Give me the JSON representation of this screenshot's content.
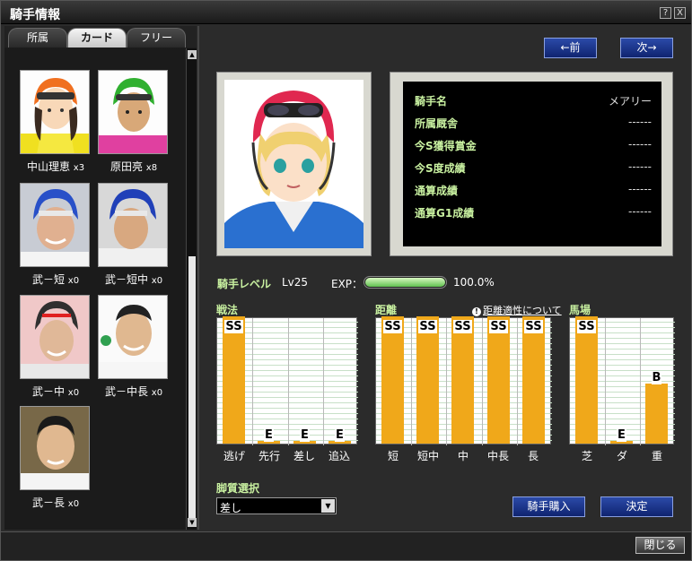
{
  "window": {
    "title": "騎手情報",
    "help": "?",
    "close": "X"
  },
  "tabs": [
    {
      "label": "所属"
    },
    {
      "label": "カード"
    },
    {
      "label": "フリー"
    }
  ],
  "cards": [
    {
      "name": "中山理恵",
      "count": "x3"
    },
    {
      "name": "原田亮",
      "count": "x8"
    },
    {
      "name": "武－短",
      "count": "x0"
    },
    {
      "name": "武－短中",
      "count": "x0"
    },
    {
      "name": "武－中",
      "count": "x0"
    },
    {
      "name": "武－中長",
      "count": "x0"
    },
    {
      "name": "武－長",
      "count": "x0"
    }
  ],
  "nav": {
    "prev": "←前",
    "next": "次→"
  },
  "info": [
    {
      "label": "騎手名",
      "value": "メアリー"
    },
    {
      "label": "所属厩舎",
      "value": "------"
    },
    {
      "label": "今S獲得賞金",
      "value": "------"
    },
    {
      "label": "今S度成績",
      "value": "------"
    },
    {
      "label": "通算成績",
      "value": "------"
    },
    {
      "label": "通算G1成績",
      "value": "------"
    }
  ],
  "level": {
    "label": "騎手レベル",
    "value": "Lv25",
    "exp_label": "EXP：",
    "exp_percent_text": "100.0%",
    "exp_fraction": 1.0
  },
  "tactics": {
    "title": "戦法",
    "items": [
      {
        "label": "逃げ",
        "grade": "SS",
        "level": 1.0
      },
      {
        "label": "先行",
        "grade": "E",
        "level": 0.02
      },
      {
        "label": "差し",
        "grade": "E",
        "level": 0.02
      },
      {
        "label": "追込",
        "grade": "E",
        "level": 0.02
      }
    ]
  },
  "distance": {
    "title": "距離",
    "note": "距離適性について",
    "items": [
      {
        "label": "短",
        "grade": "SS",
        "level": 1.0
      },
      {
        "label": "短中",
        "grade": "SS",
        "level": 1.0
      },
      {
        "label": "中",
        "grade": "SS",
        "level": 1.0
      },
      {
        "label": "中長",
        "grade": "SS",
        "level": 1.0
      },
      {
        "label": "長",
        "grade": "SS",
        "level": 1.0
      }
    ]
  },
  "track": {
    "title": "馬場",
    "items": [
      {
        "label": "芝",
        "grade": "SS",
        "level": 1.0
      },
      {
        "label": "ダ",
        "grade": "E",
        "level": 0.02
      },
      {
        "label": "重",
        "grade": "B",
        "level": 0.47
      }
    ]
  },
  "style": {
    "label": "脚質選択",
    "selected": "差し"
  },
  "actions": {
    "buy": "騎手購入",
    "confirm": "決定",
    "close": "閉じる"
  },
  "colors": {
    "accent_green": "#c8f0a0",
    "bar": "#f0a81a",
    "button_blue": "#1c3a90"
  }
}
